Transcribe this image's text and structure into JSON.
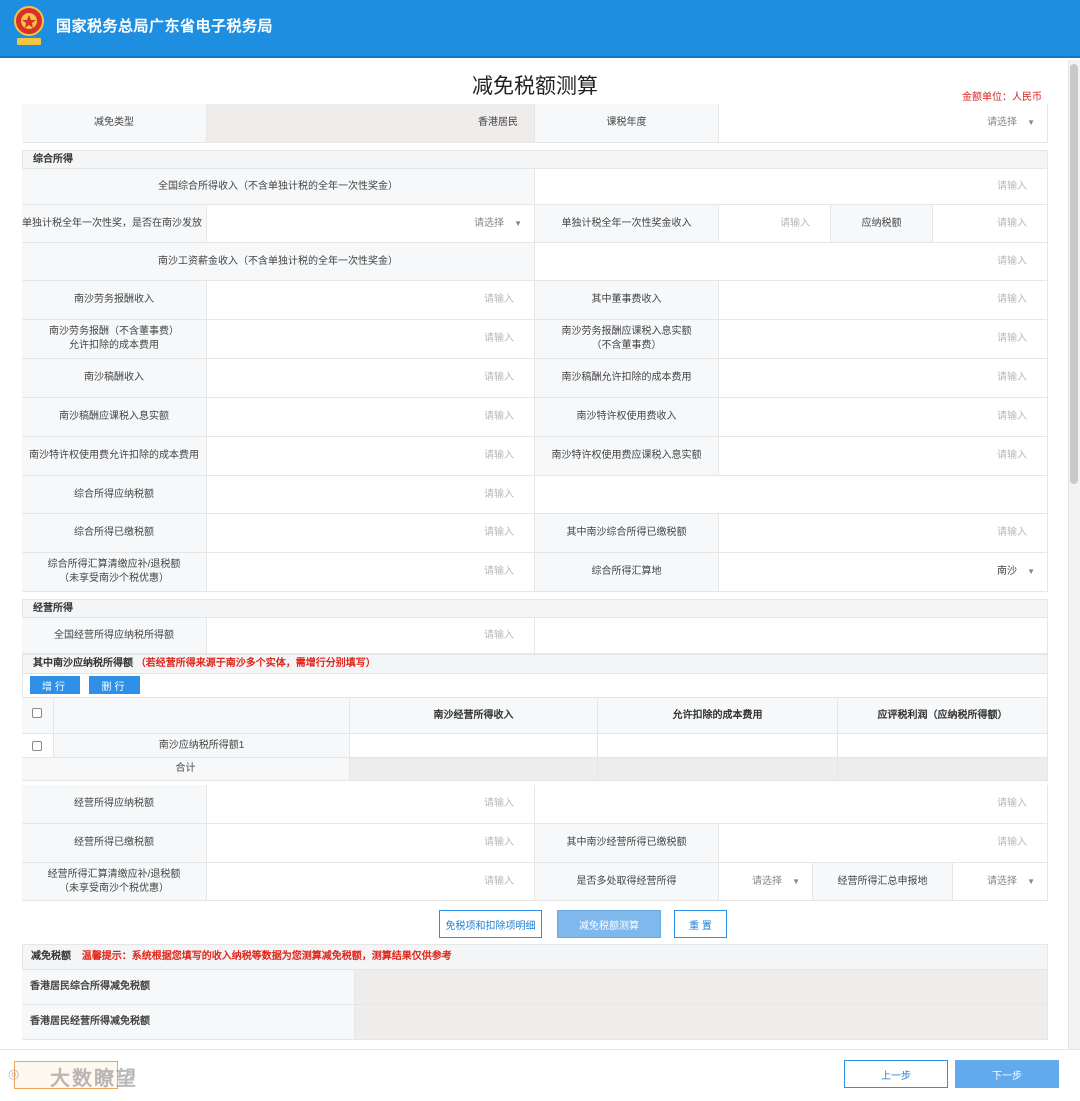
{
  "header": {
    "title": "国家税务总局广东省电子税务局"
  },
  "page": {
    "title": "减免税额测算",
    "unit_note": "金额单位：人民币"
  },
  "placeholders": {
    "input": "请输入",
    "select": "请选择"
  },
  "top_row": {
    "reduction_type_label": "减免类型",
    "reduction_type_value": "香港居民",
    "tax_year_label": "课税年度"
  },
  "comprehensive": {
    "section_title": "综合所得",
    "national_income_label": "全国综合所得收入（不含单独计税的全年一次性奖金）",
    "bonus_nansha_label": "单独计税全年一次性奖，是否在南沙发放",
    "bonus_income_label": "单独计税全年一次性奖金收入",
    "tax_payable_label": "应纳税额",
    "nansha_wage_label": "南沙工资薪金收入（不含单独计税的全年一次性奖金）",
    "labor_income_label": "南沙劳务报酬收入",
    "director_fee_label": "其中董事费收入",
    "labor_cost_label_1": "南沙劳务报酬（不含董事费）",
    "labor_cost_label_2": "允许扣除的成本费用",
    "labor_taxable_label_1": "南沙劳务报酬应课税入息实额",
    "labor_taxable_label_2": "（不含董事费）",
    "author_income_label": "南沙稿酬收入",
    "author_cost_label": "南沙稿酬允许扣除的成本费用",
    "author_taxable_label": "南沙稿酬应课税入息实额",
    "royalty_income_label": "南沙特许权使用费收入",
    "royalty_cost_label": "南沙特许权使用费允许扣除的成本费用",
    "royalty_taxable_label": "南沙特许权使用费应课税入息实额",
    "tax_due_label": "综合所得应纳税额",
    "tax_paid_label": "综合所得已缴税额",
    "nansha_tax_paid_label": "其中南沙综合所得已缴税额",
    "settlement_label_1": "综合所得汇算清缴应补/退税额",
    "settlement_label_2": "（未享受南沙个税优惠）",
    "settlement_place_label": "综合所得汇算地",
    "settlement_place_value": "南沙"
  },
  "business": {
    "section_title": "经营所得",
    "national_taxable_label": "全国经营所得应纳税所得额",
    "nansha_taxable_title": "其中南沙应纳税所得额",
    "nansha_taxable_note": "（若经营所得来源于南沙多个实体，需增行分别填写）",
    "add_row": "增行",
    "delete_row": "删行",
    "table_headers": [
      "南沙经营所得收入",
      "允许扣除的成本费用",
      "应评税利润（应纳税所得额）"
    ],
    "row_label": "南沙应纳税所得额1",
    "total_label": "合计",
    "tax_due_label": "经营所得应纳税额",
    "tax_paid_label": "经营所得已缴税额",
    "nansha_tax_paid_label": "其中南沙经营所得已缴税额",
    "settlement_label_1": "经营所得汇算清缴应补/退税额",
    "settlement_label_2": "（未享受南沙个税优惠）",
    "multi_source_label": "是否多处取得经营所得",
    "declare_place_label": "经营所得汇总申报地"
  },
  "actions": {
    "detail": "免税项和扣除项明细",
    "calculate": "减免税额测算",
    "reset": "重 置"
  },
  "result": {
    "section_title": "减免税额",
    "tip": "温馨提示：系统根据您填写的收入纳税等数据为您测算减免税额，测算结果仅供参考",
    "comprehensive_label": "香港居民综合所得减免税额",
    "business_label": "香港居民经营所得减免税额"
  },
  "footer": {
    "prev": "上一步",
    "next": "下一步",
    "watermark": "大数瞭望"
  }
}
